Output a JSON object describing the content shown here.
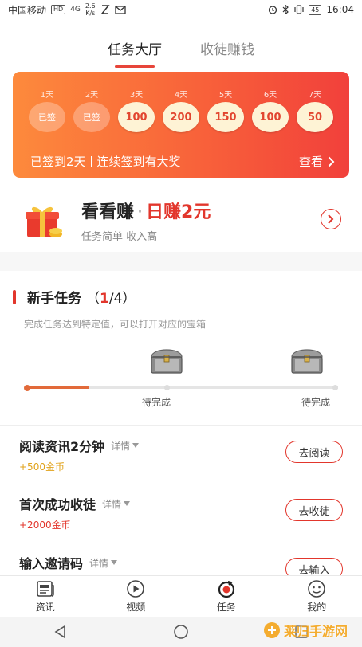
{
  "status_bar": {
    "carrier": "中国移动",
    "hd_badge": "HD",
    "network": "4G",
    "speed_value": "2.6",
    "speed_unit": "K/s",
    "battery": "45",
    "time": "16:04"
  },
  "top_tabs": [
    {
      "label": "任务大厅",
      "active": true
    },
    {
      "label": "收徒赚钱",
      "active": false
    }
  ],
  "sign_in": {
    "days": [
      {
        "label": "1天",
        "value": "已签",
        "signed": true
      },
      {
        "label": "2天",
        "value": "已签",
        "signed": true
      },
      {
        "label": "3天",
        "value": "100",
        "signed": false
      },
      {
        "label": "4天",
        "value": "200",
        "signed": false
      },
      {
        "label": "5天",
        "value": "150",
        "signed": false
      },
      {
        "label": "6天",
        "value": "100",
        "signed": false
      },
      {
        "label": "7天",
        "value": "50",
        "signed": false
      }
    ],
    "status_text": "已签到2天",
    "promo_text": "连续签到有大奖",
    "view_label": "查看"
  },
  "watch_earn": {
    "title": "看看赚",
    "dot": "·",
    "highlight": "日赚2元",
    "subtitle": "任务简单 收入高"
  },
  "newbie": {
    "title": "新手任务",
    "count_open": "（",
    "count_done": "1",
    "count_sep": "/4",
    "count_close": "）",
    "description": "完成任务达到特定值，可以打开对应的宝箱",
    "progress": 0.2,
    "chests": [
      {
        "label": "待完成"
      },
      {
        "label": "待完成"
      }
    ]
  },
  "tasks": [
    {
      "name": "阅读资讯2分钟",
      "detail": "详情",
      "reward": "+500金币",
      "reward_color": "#e0a21a",
      "button": "去阅读"
    },
    {
      "name": "首次成功收徒",
      "detail": "详情",
      "reward": "+2000金币",
      "reward_color": "#e2362c",
      "button": "去收徒"
    },
    {
      "name": "输入邀请码",
      "detail": "详情",
      "reward": "",
      "reward_color": "#e2362c",
      "button": "去输入"
    }
  ],
  "bottom_nav": [
    {
      "label": "资讯",
      "icon": "news-icon"
    },
    {
      "label": "视频",
      "icon": "video-play-icon"
    },
    {
      "label": "任务",
      "icon": "task-icon",
      "active": true
    },
    {
      "label": "我的",
      "icon": "profile-icon"
    }
  ],
  "watermark": {
    "text": "莱归手游网"
  },
  "colors": {
    "accent": "#e2362c",
    "card_start": "#fd8a3c",
    "card_end": "#f1403b"
  }
}
